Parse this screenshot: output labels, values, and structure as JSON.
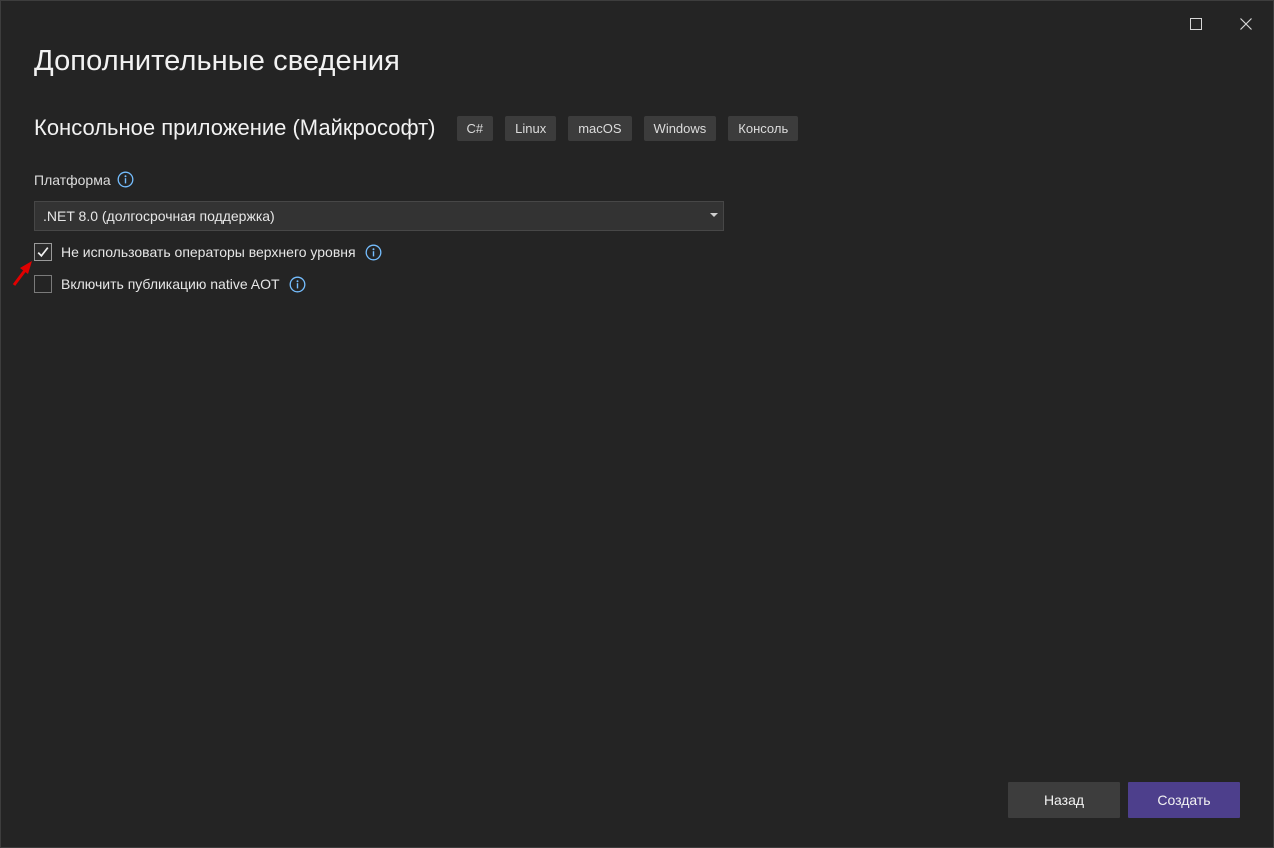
{
  "window": {
    "maximize_icon": "maximize-icon",
    "close_icon": "close-icon"
  },
  "page": {
    "title": "Дополнительные сведения"
  },
  "template": {
    "name": "Консольное приложение (Майкрософт)",
    "tags": [
      "C#",
      "Linux",
      "macOS",
      "Windows",
      "Консоль"
    ]
  },
  "platform": {
    "label": "Платформа",
    "selected": ".NET 8.0 (долгосрочная поддержка)"
  },
  "options": [
    {
      "label": "Не использовать операторы верхнего уровня",
      "checked": true
    },
    {
      "label": "Включить публикацию native AOT",
      "checked": false
    }
  ],
  "buttons": {
    "back": "Назад",
    "create": "Создать"
  },
  "colors": {
    "background": "#242424",
    "accent": "#4d3f8c",
    "info_icon": "#75beff",
    "annotation_arrow": "#e00000"
  }
}
